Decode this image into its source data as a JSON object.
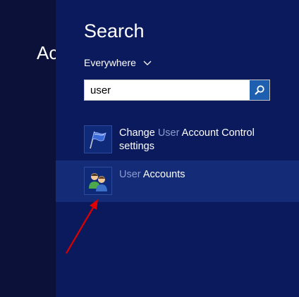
{
  "background": {
    "title_partial": "Ac"
  },
  "search": {
    "title": "Search",
    "scope": "Everywhere",
    "query": "user"
  },
  "results": [
    {
      "highlight": "User",
      "before": "Change ",
      "after": " Account Control settings",
      "icon": "flag-icon"
    },
    {
      "highlight": "User",
      "before": "",
      "after": " Accounts",
      "icon": "users-icon"
    }
  ],
  "colors": {
    "panel": "#0b1a5c",
    "selected": "#142c78",
    "search_button": "#1e5fb0",
    "arrow": "#e00000"
  }
}
